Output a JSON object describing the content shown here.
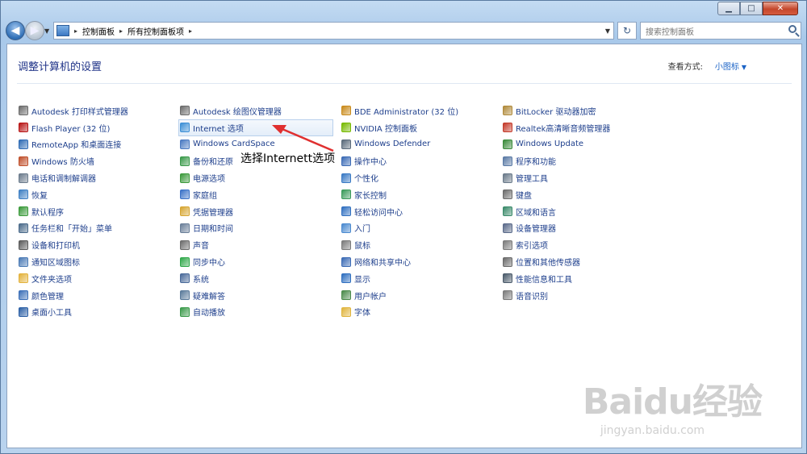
{
  "window": {
    "minimize": "▁",
    "maximize": "□",
    "close": "✕"
  },
  "nav": {
    "back": "◀",
    "forward": "▶",
    "breadcrumb": [
      "控制面板",
      "所有控制面板项"
    ],
    "separator": "▸",
    "refresh": "↻"
  },
  "search": {
    "placeholder": "搜索控制面板"
  },
  "header": {
    "title": "调整计算机的设置",
    "view_by_label": "查看方式:",
    "view_by_value": "小图标",
    "view_by_caret": "▼"
  },
  "columns": [
    [
      {
        "label": "Autodesk 打印样式管理器",
        "icon": "printer-style-icon",
        "color": "#6b6b6b"
      },
      {
        "label": "Flash Player (32 位)",
        "icon": "flash-icon",
        "color": "#b81414"
      },
      {
        "label": "RemoteApp 和桌面连接",
        "icon": "remoteapp-icon",
        "color": "#2e6bb5"
      },
      {
        "label": "Windows 防火墙",
        "icon": "firewall-icon",
        "color": "#c0502b"
      },
      {
        "label": "电话和调制解调器",
        "icon": "phone-modem-icon",
        "color": "#6b7b8c"
      },
      {
        "label": "恢复",
        "icon": "recovery-icon",
        "color": "#3d7fc4"
      },
      {
        "label": "默认程序",
        "icon": "default-programs-icon",
        "color": "#3a9a3a"
      },
      {
        "label": "任务栏和「开始」菜单",
        "icon": "taskbar-icon",
        "color": "#4a6a8a"
      },
      {
        "label": "设备和打印机",
        "icon": "printer-icon",
        "color": "#5a5a5a"
      },
      {
        "label": "通知区域图标",
        "icon": "notification-icon",
        "color": "#4a7ab5"
      },
      {
        "label": "文件夹选项",
        "icon": "folder-icon",
        "color": "#e3b23c"
      },
      {
        "label": "颜色管理",
        "icon": "color-management-icon",
        "color": "#3b6fb8"
      },
      {
        "label": "桌面小工具",
        "icon": "gadgets-icon",
        "color": "#2b5fa5"
      }
    ],
    [
      {
        "label": "Autodesk 绘图仪管理器",
        "icon": "plotter-icon",
        "color": "#6b6b6b"
      },
      {
        "label": "Internet 选项",
        "icon": "internet-options-icon",
        "color": "#3c8fd6",
        "selected": true
      },
      {
        "label": "Windows CardSpace",
        "icon": "cardspace-icon",
        "color": "#4a7ac2"
      },
      {
        "label": "备份和还原",
        "icon": "backup-icon",
        "color": "#3a9a4a"
      },
      {
        "label": "电源选项",
        "icon": "power-icon",
        "color": "#3c9a3c"
      },
      {
        "label": "家庭组",
        "icon": "homegroup-icon",
        "color": "#3a72c8"
      },
      {
        "label": "凭据管理器",
        "icon": "credential-icon",
        "color": "#d6a531"
      },
      {
        "label": "日期和时间",
        "icon": "clock-icon",
        "color": "#6a7f99"
      },
      {
        "label": "声音",
        "icon": "sound-icon",
        "color": "#6b6b6b"
      },
      {
        "label": "同步中心",
        "icon": "sync-icon",
        "color": "#2fa84a"
      },
      {
        "label": "系统",
        "icon": "system-icon",
        "color": "#4a6a9a"
      },
      {
        "label": "疑难解答",
        "icon": "troubleshoot-icon",
        "color": "#5a7a9a"
      },
      {
        "label": "自动播放",
        "icon": "autoplay-icon",
        "color": "#3a9a4a"
      }
    ],
    [
      {
        "label": "BDE Administrator (32 位)",
        "icon": "bde-icon",
        "color": "#c98a1a"
      },
      {
        "label": "NVIDIA 控制面板",
        "icon": "nvidia-icon",
        "color": "#76b900"
      },
      {
        "label": "Windows Defender",
        "icon": "defender-icon",
        "color": "#5a6a7a"
      },
      {
        "label": "操作中心",
        "icon": "action-center-icon",
        "color": "#3a6ab5"
      },
      {
        "label": "个性化",
        "icon": "personalization-icon",
        "color": "#3a7ac5"
      },
      {
        "label": "家长控制",
        "icon": "parental-control-icon",
        "color": "#3a9a5a"
      },
      {
        "label": "轻松访问中心",
        "icon": "ease-of-access-icon",
        "color": "#2f6fc0"
      },
      {
        "label": "入门",
        "icon": "getting-started-icon",
        "color": "#4a8ad0"
      },
      {
        "label": "鼠标",
        "icon": "mouse-icon",
        "color": "#7a7a7a"
      },
      {
        "label": "网络和共享中心",
        "icon": "network-icon",
        "color": "#3a6ab5"
      },
      {
        "label": "显示",
        "icon": "display-icon",
        "color": "#2f6fc0"
      },
      {
        "label": "用户帐户",
        "icon": "user-accounts-icon",
        "color": "#4a8a4a"
      },
      {
        "label": "字体",
        "icon": "fonts-icon",
        "color": "#e0b43c"
      }
    ],
    [
      {
        "label": "BitLocker 驱动器加密",
        "icon": "bitlocker-icon",
        "color": "#b08a3a"
      },
      {
        "label": "Realtek高清晰音频管理器",
        "icon": "realtek-icon",
        "color": "#c43a2a"
      },
      {
        "label": "Windows Update",
        "icon": "windows-update-icon",
        "color": "#3a8a3a"
      },
      {
        "label": "程序和功能",
        "icon": "programs-icon",
        "color": "#5a7aa5"
      },
      {
        "label": "管理工具",
        "icon": "admin-tools-icon",
        "color": "#6a7a8a"
      },
      {
        "label": "键盘",
        "icon": "keyboard-icon",
        "color": "#6b6b6b"
      },
      {
        "label": "区域和语言",
        "icon": "region-icon",
        "color": "#3a8a6a"
      },
      {
        "label": "设备管理器",
        "icon": "device-manager-icon",
        "color": "#5a6a8a"
      },
      {
        "label": "索引选项",
        "icon": "indexing-icon",
        "color": "#7a7a7a"
      },
      {
        "label": "位置和其他传感器",
        "icon": "location-icon",
        "color": "#6a6a6a"
      },
      {
        "label": "性能信息和工具",
        "icon": "performance-icon",
        "color": "#4a5a6a"
      },
      {
        "label": "语音识别",
        "icon": "microphone-icon",
        "color": "#7a7a7a"
      }
    ]
  ],
  "annotation": {
    "text": "选择Internett选项",
    "color": "#e03030"
  },
  "watermark": {
    "main": "Baidu经验",
    "sub": "jingyan.baidu.com"
  }
}
